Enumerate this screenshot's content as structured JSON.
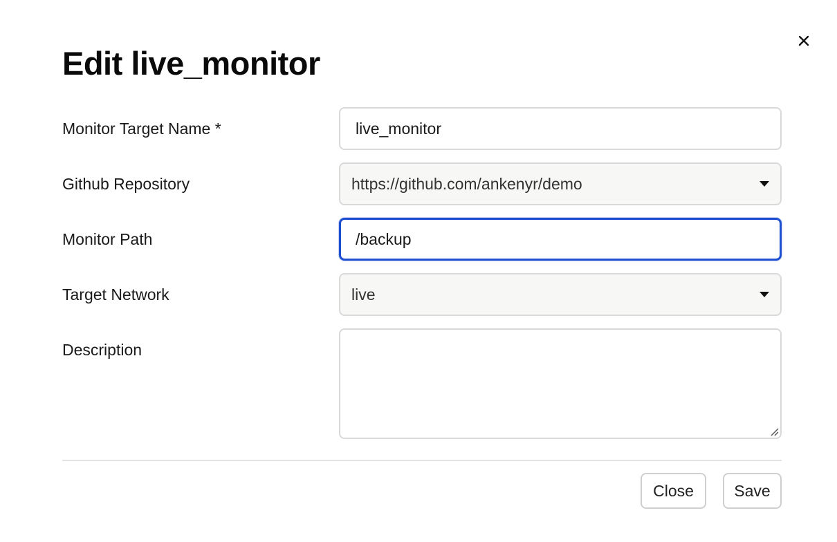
{
  "dialog": {
    "title": "Edit live_monitor",
    "close_icon": "close-icon"
  },
  "form": {
    "monitor_target_name": {
      "label": "Monitor Target Name *",
      "value": "live_monitor"
    },
    "github_repository": {
      "label": "Github Repository",
      "selected": "https://github.com/ankenyr/demo"
    },
    "monitor_path": {
      "label": "Monitor Path",
      "value": "/backup"
    },
    "target_network": {
      "label": "Target Network",
      "selected": "live"
    },
    "description": {
      "label": "Description",
      "value": ""
    }
  },
  "footer": {
    "close_label": "Close",
    "save_label": "Save"
  },
  "colors": {
    "focus_border": "#1f4fd1",
    "input_border": "#d9d9d9",
    "select_background": "#f7f7f5"
  }
}
